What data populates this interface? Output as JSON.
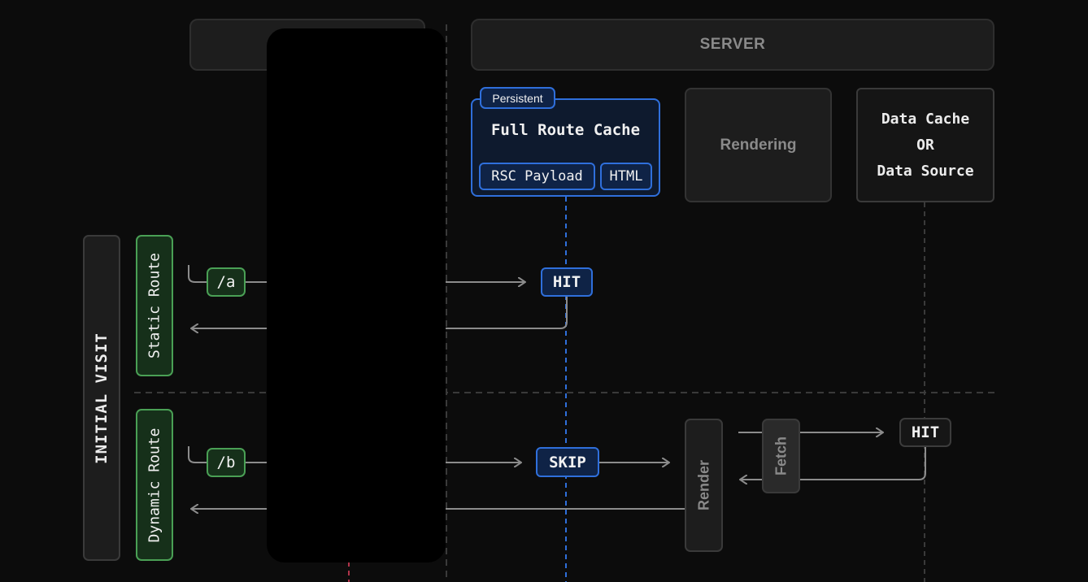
{
  "header": {
    "server": "SERVER",
    "client": ""
  },
  "full_route_cache": {
    "badge": "Persistent",
    "title": "Full Route Cache",
    "rsc": "RSC Payload",
    "html": "HTML"
  },
  "rendering": "Rendering",
  "data_cache": {
    "line1": "Data Cache",
    "line2": "OR",
    "line3": "Data Source"
  },
  "row_group": "INITIAL VISIT",
  "static_route": {
    "label": "Static Route",
    "path": "/a",
    "status": "HIT"
  },
  "dynamic_route": {
    "label": "Dynamic Route",
    "path": "/b",
    "status": "SKIP",
    "render": "Render",
    "fetch": "Fetch",
    "data_status": "HIT"
  },
  "colors": {
    "blue": "#2f6fdb",
    "green": "#4aa055",
    "dark": "#1d1d1d",
    "line": "#8c8c8c",
    "dashed": "#3a3a3a",
    "red_dashed": "#b0344a"
  }
}
